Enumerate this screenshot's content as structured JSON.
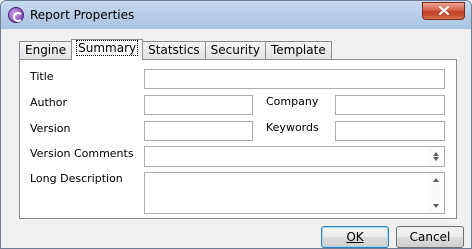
{
  "window": {
    "title": "Report Properties"
  },
  "tabs": [
    {
      "label": "Engine"
    },
    {
      "label": "Summary",
      "active": true
    },
    {
      "label": "Statstics"
    },
    {
      "label": "Security"
    },
    {
      "label": "Template"
    }
  ],
  "form": {
    "title": {
      "label": "Title",
      "value": ""
    },
    "author": {
      "label": "Author",
      "value": ""
    },
    "company": {
      "label": "Company",
      "value": ""
    },
    "version": {
      "label": "Version",
      "value": ""
    },
    "keywords": {
      "label": "Keywords",
      "value": ""
    },
    "version_comments": {
      "label": "Version Comments",
      "value": ""
    },
    "long_description": {
      "label": "Long Description",
      "value": ""
    }
  },
  "buttons": {
    "ok": "OK",
    "cancel": "Cancel"
  },
  "icons": {
    "app": "report-app-icon",
    "close": "close-icon"
  }
}
